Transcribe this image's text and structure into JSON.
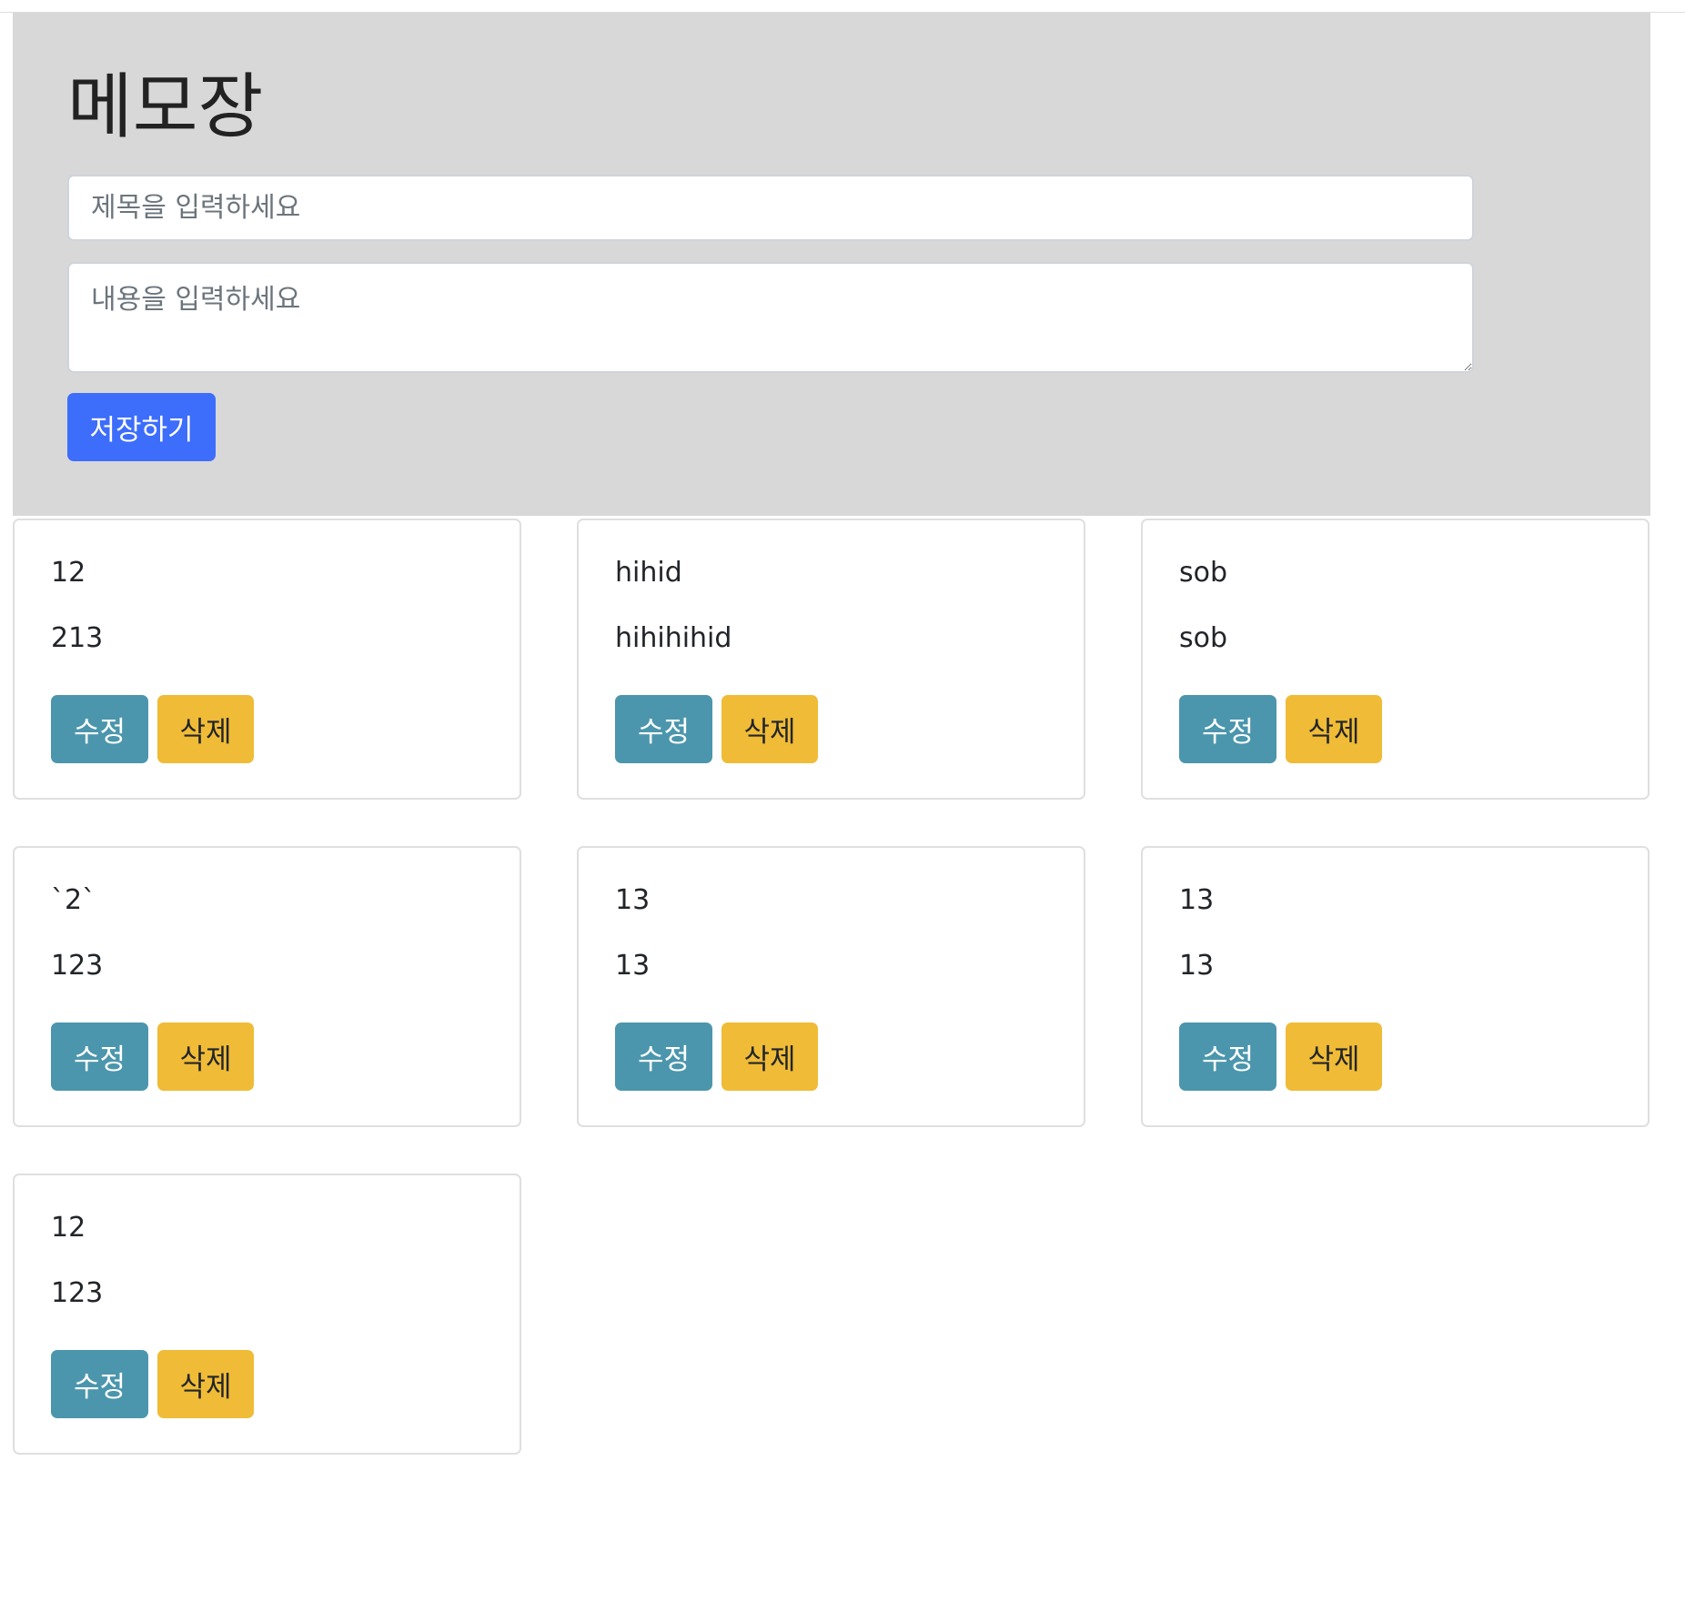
{
  "header": {
    "title": "메모장"
  },
  "form": {
    "title_placeholder": "제목을 입력하세요",
    "title_value": "",
    "content_placeholder": "내용을 입력하세요",
    "content_value": "",
    "save_label": "저장하기"
  },
  "memos": [
    {
      "title": "12",
      "content": "213",
      "edit_label": "수정",
      "delete_label": "삭제"
    },
    {
      "title": "hihid",
      "content": "hihihihid",
      "edit_label": "수정",
      "delete_label": "삭제"
    },
    {
      "title": "sob",
      "content": "sob",
      "edit_label": "수정",
      "delete_label": "삭제"
    },
    {
      "title": "`2`",
      "content": "123",
      "edit_label": "수정",
      "delete_label": "삭제"
    },
    {
      "title": "13",
      "content": "13",
      "edit_label": "수정",
      "delete_label": "삭제"
    },
    {
      "title": "13",
      "content": "13",
      "edit_label": "수정",
      "delete_label": "삭제"
    },
    {
      "title": "12",
      "content": "123",
      "edit_label": "수정",
      "delete_label": "삭제"
    }
  ],
  "colors": {
    "header_bg": "#d8d8d8",
    "primary": "#3d6dfb",
    "edit": "#4b96ad",
    "delete": "#f0bb36"
  }
}
